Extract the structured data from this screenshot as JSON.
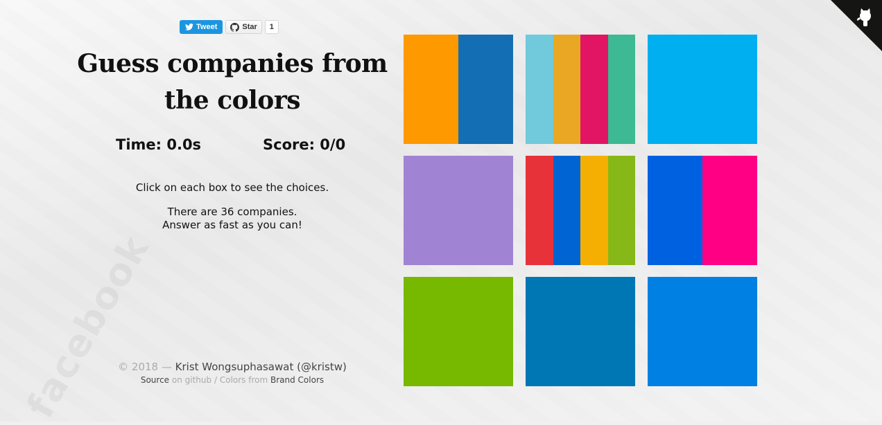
{
  "social": {
    "tweet_label": "Tweet",
    "star_label": "Star",
    "star_count": "1"
  },
  "title": "Guess companies from the colors",
  "stats": {
    "time": "Time: 0.0s",
    "score": "Score: 0/0"
  },
  "instructions": {
    "line1": "Click on each box to see the choices.",
    "line2": "There are 36 companies.",
    "line3": "Answer as fast as you can!"
  },
  "footer": {
    "copyright": "© 2018 —",
    "author": "Krist Wongsuphasawat",
    "handle": "(@kristw)",
    "source_label": "Source",
    "github_label": "on github",
    "separator": "/",
    "colors_from_label": "Colors from",
    "brand_colors_label": "Brand Colors"
  },
  "background_watermark": "facebook",
  "corner_icon": "github-octocat-icon",
  "tiles": [
    {
      "colors": [
        "#ff9900",
        "#146eb4"
      ]
    },
    {
      "colors": [
        "#71c9dc",
        "#e9a724",
        "#e11564",
        "#3db993"
      ]
    },
    {
      "colors": [
        "#00aff0"
      ]
    },
    {
      "colors": [
        "#a084d3"
      ]
    },
    {
      "colors": [
        "#e8323a",
        "#0064d2",
        "#f5af02",
        "#86b817"
      ]
    },
    {
      "colors": [
        "#0061e0",
        "#ff0084"
      ]
    },
    {
      "colors": [
        "#76b900"
      ]
    },
    {
      "colors": [
        "#0077b5"
      ]
    },
    {
      "colors": [
        "#0080e3"
      ]
    }
  ]
}
